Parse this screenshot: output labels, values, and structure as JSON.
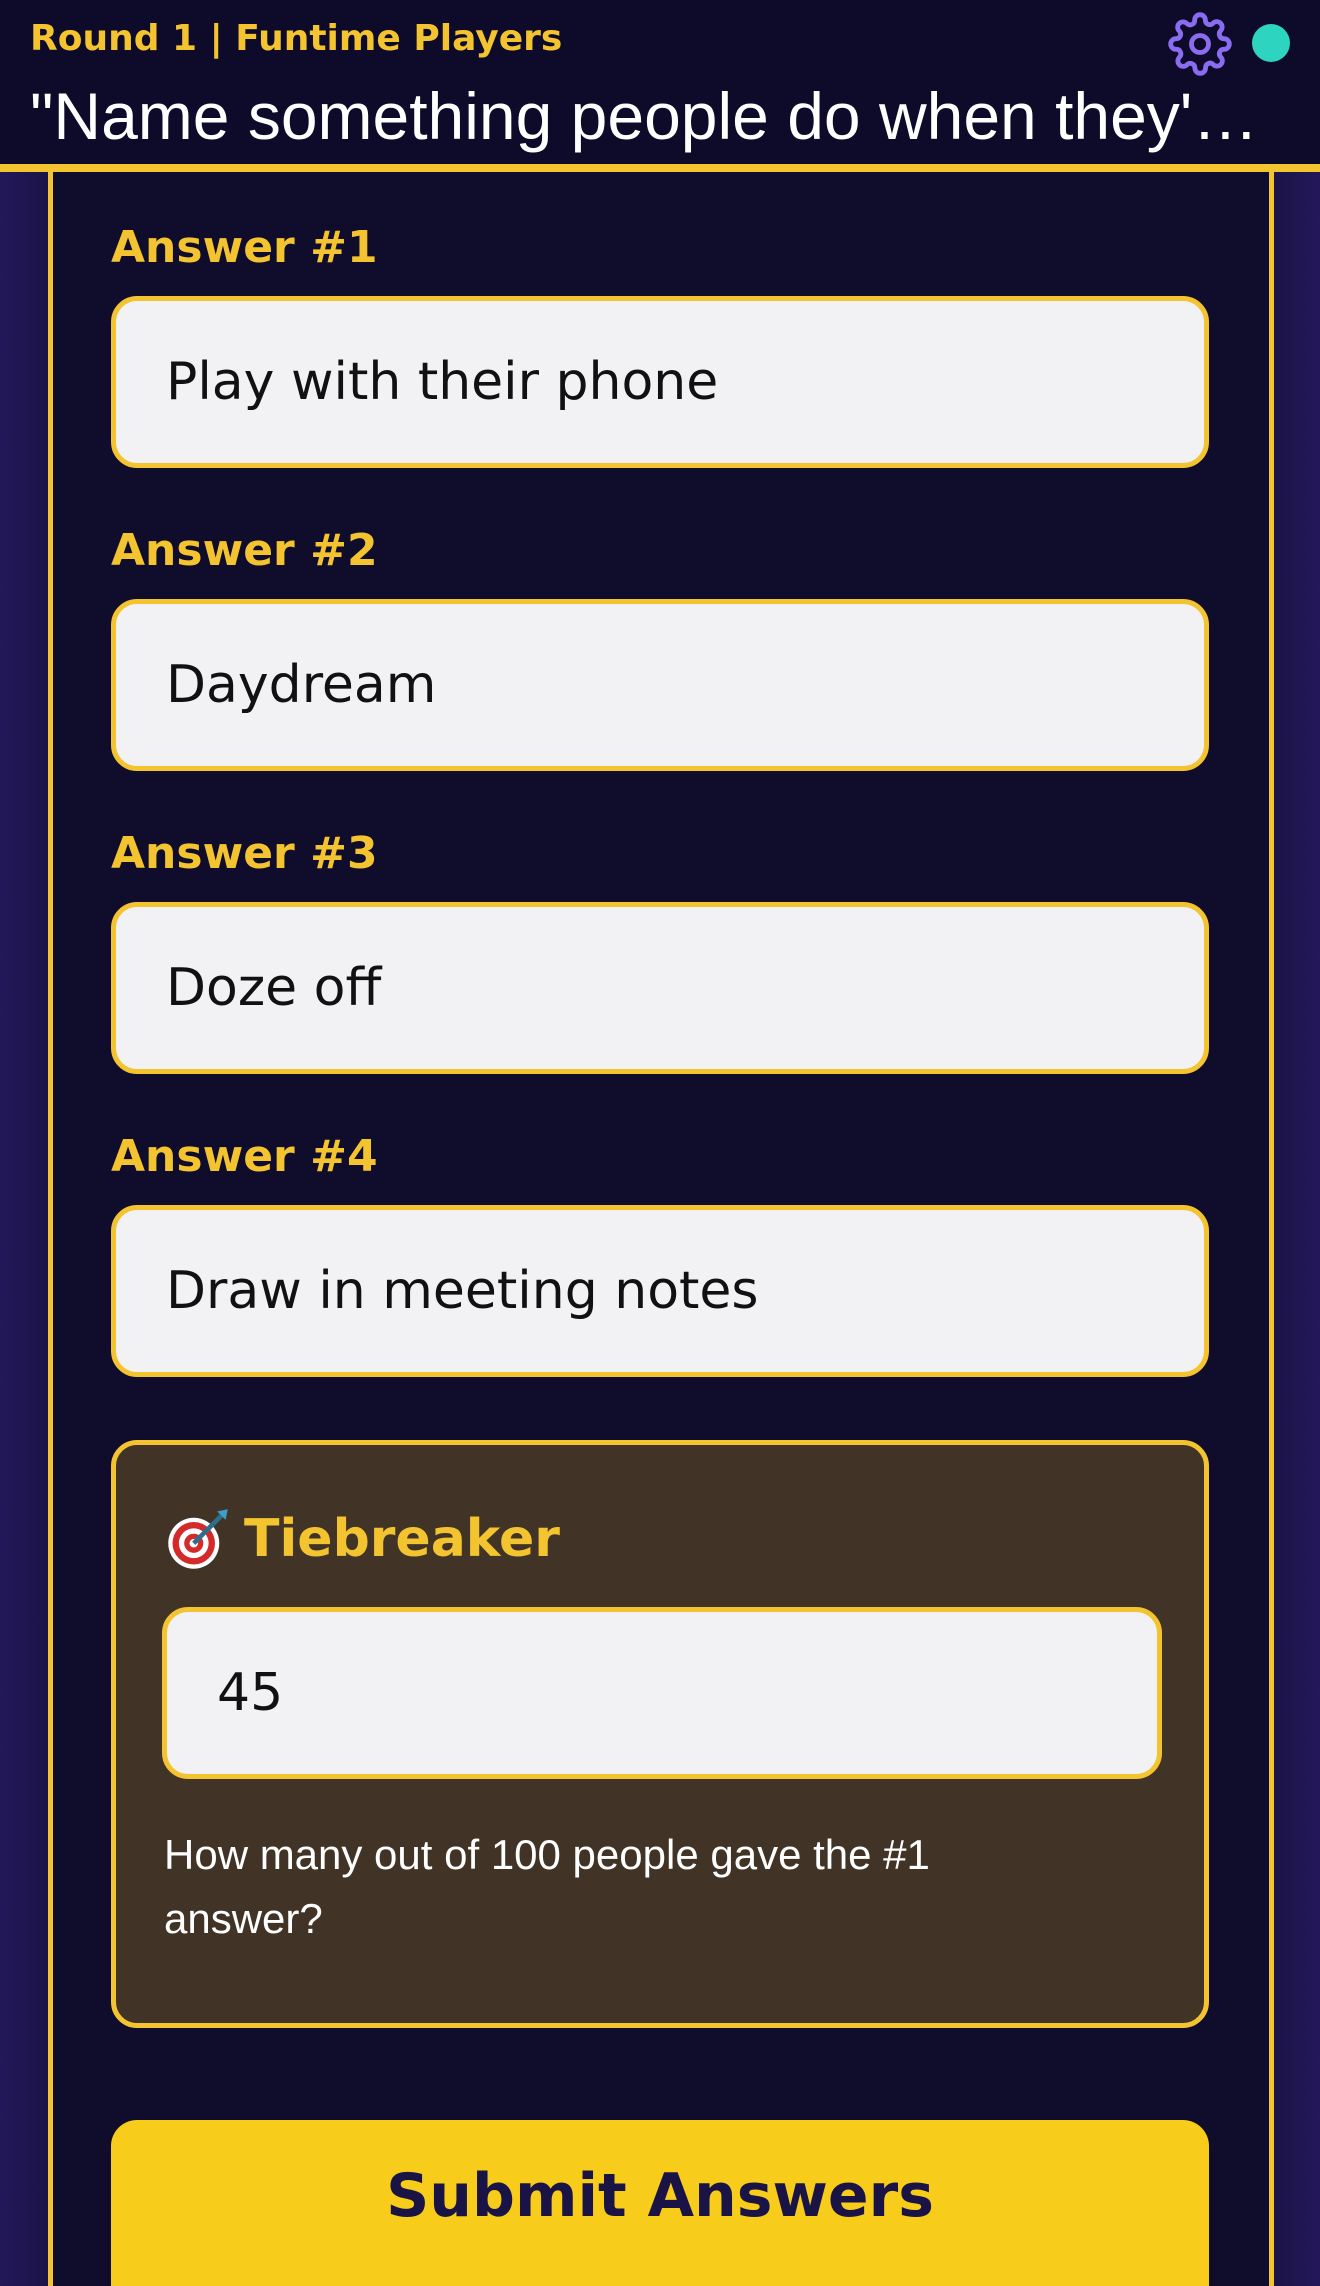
{
  "header": {
    "round_label": "Round 1 | Funtime Players",
    "question": "\"Name something people do when they'…"
  },
  "answers": [
    {
      "label": "Answer #1",
      "value": "Play with their phone"
    },
    {
      "label": "Answer #2",
      "value": "Daydream"
    },
    {
      "label": "Answer #3",
      "value": "Doze off"
    },
    {
      "label": "Answer #4",
      "value": "Draw in meeting notes"
    }
  ],
  "tiebreaker": {
    "icon": "dart-target-icon",
    "title": "Tiebreaker",
    "value": "45",
    "hint": "How many out of 100 people gave the #1 answer?"
  },
  "submit_label": "Submit Answers",
  "colors": {
    "accent": "#f4c430",
    "header_bg": "#0e0b2a",
    "panel_bg": "#100c2b",
    "status": "#2dd4bf",
    "gear": "#8b6cf0",
    "tiebreaker_bg": "#413426",
    "submit_bg": "#f8cc1b"
  }
}
